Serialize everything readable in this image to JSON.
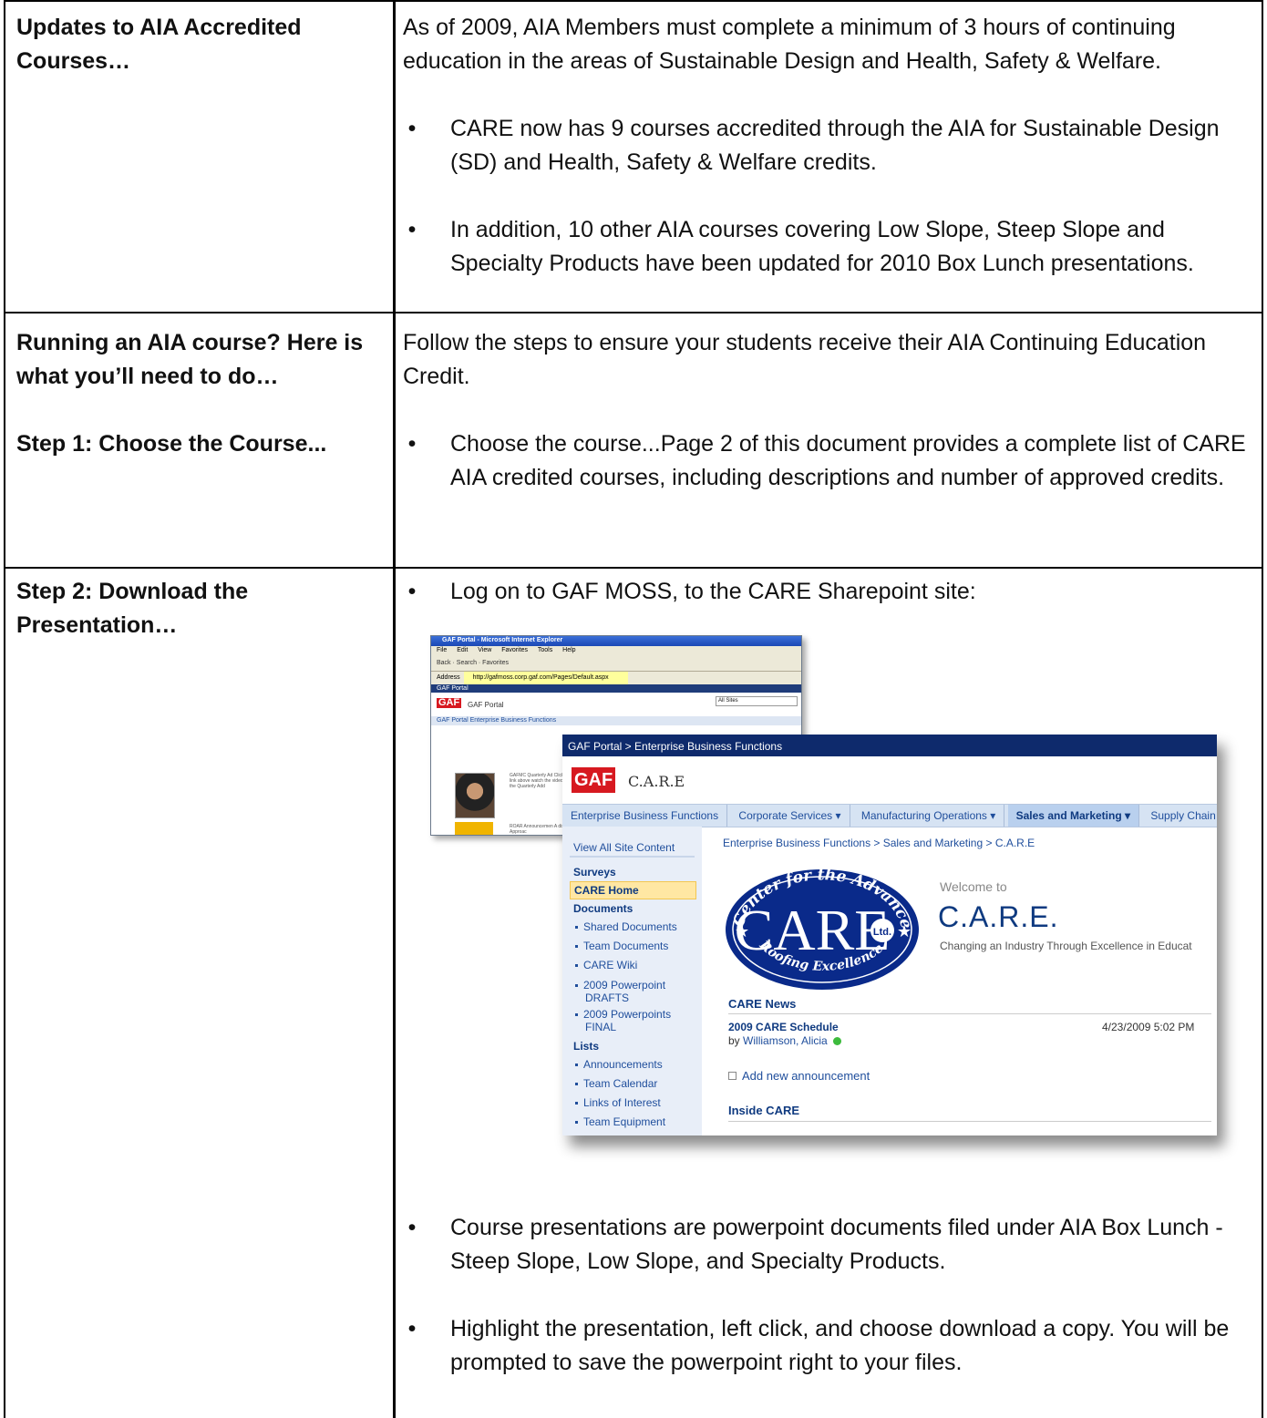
{
  "rows": [
    {
      "left_heading": "Updates to AIA Accredited Courses…",
      "intro": "As of 2009, AIA Members must complete a minimum of 3 hours of continuing education in the areas of Sustainable Design and Health, Safety & Welfare.",
      "bullets": [
        "CARE now has 9 courses accredited through the AIA for Sustainable Design (SD) and Health, Safety & Welfare credits.",
        "In addition, 10 other AIA courses covering Low Slope, Steep Slope and Specialty Products have been updated for 2010 Box Lunch presentations."
      ]
    },
    {
      "left_heading": "Running an AIA course? Here is what you’ll need to do…",
      "step1_heading": "Step 1: Choose the Course...",
      "intro": "Follow the steps to ensure your students receive their AIA Continuing Education Credit.",
      "bullets": [
        "Choose the course...Page 2 of this document provides a complete list of CARE AIA credited courses, including descriptions and number of approved credits."
      ]
    },
    {
      "left_heading": "Step 2: Download the Presentation…",
      "bullets": [
        "Log on to GAF MOSS, to the CARE Sharepoint site:",
        "Course presentations are powerpoint documents filed under AIA Box Lunch - Steep Slope, Low Slope, and Specialty Products.",
        "Highlight the presentation, left click, and choose download a copy. You will be prompted to save the powerpoint right to your files."
      ]
    }
  ],
  "bullet_glyph": "•",
  "screenshot": {
    "ie": {
      "title": "GAF Portal - Microsoft Internet Explorer",
      "menu": [
        "File",
        "Edit",
        "View",
        "Favorites",
        "Tools",
        "Help"
      ],
      "nav": "Back · Search · Favorites",
      "address_label": "Address",
      "url": "http://gafmoss.corp.gaf.com/Pages/Default.aspx",
      "portal_bar": "GAF Portal",
      "logo": "GAF",
      "portal_name": "GAF Portal",
      "tabs": "GAF Portal    Enterprise Business Functions",
      "all_sites": "All Sites",
      "news1": "GAFMC Quarterly Ad Click on the link above watch the video or li to the Quarterly Add",
      "news2": "ROAR Announcemen A disciplined Approac"
    },
    "sharepoint": {
      "breadcrumb_top": "GAF Portal > Enterprise Business Functions",
      "logo": "GAF",
      "site_name": "C.A.R.E",
      "nav": [
        "Enterprise Business Functions",
        "Corporate Services ▾",
        "Manufacturing Operations ▾",
        "Sales and Marketing ▾",
        "Supply Chain"
      ],
      "view_all": "View All Site Content",
      "surveys": "Surveys",
      "care_home": "CARE Home",
      "documents": "Documents",
      "doc_items": [
        "Shared Documents",
        "Team Documents",
        "CARE Wiki"
      ],
      "doc_items2": [
        "2009 Powerpoint DRAFTS",
        "2009 Powerpoints FINAL"
      ],
      "lists": "Lists",
      "list_items": [
        "Announcements",
        "Team Calendar",
        "Links of Interest",
        "Team Equipment"
      ],
      "crumb": "Enterprise Business Functions > Sales and Marketing > C.A.R.E",
      "seal_top": "Center for the Advancement of",
      "seal_center": "CARE",
      "seal_ltd": "Ltd.",
      "seal_bottom": "Roofing Excellence",
      "welcome": "Welcome to",
      "care_title": "C.A.R.E.",
      "tagline": "Changing an Industry Through Excellence in Educat",
      "news_heading": "CARE News",
      "schedule": "2009 CARE Schedule",
      "schedule_date": "4/23/2009 5:02 PM",
      "by": "by",
      "author": "Williamson, Alicia",
      "add_new": "Add new announcement",
      "inside": "Inside CARE"
    }
  }
}
